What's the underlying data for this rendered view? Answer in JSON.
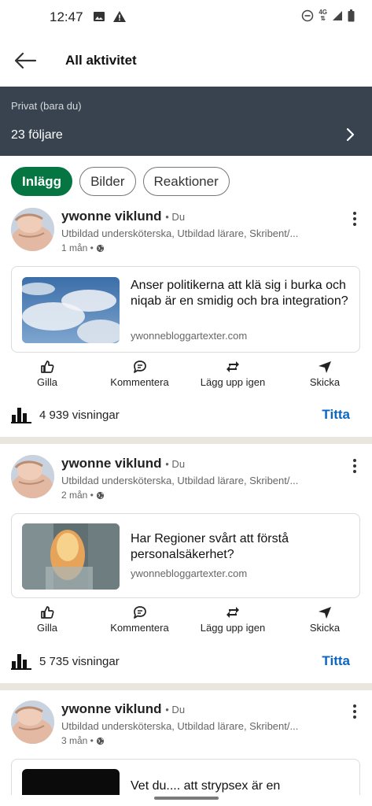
{
  "status_bar": {
    "time": "12:47",
    "network": "4G"
  },
  "header": {
    "title": "All aktivitet"
  },
  "banner": {
    "privacy": "Privat (bara du)",
    "followers": "23 följare"
  },
  "filters": [
    {
      "label": "Inlägg",
      "active": true
    },
    {
      "label": "Bilder",
      "active": false
    },
    {
      "label": "Reaktioner",
      "active": false
    }
  ],
  "actions": {
    "like": "Gilla",
    "comment": "Kommentera",
    "repost": "Lägg upp igen",
    "send": "Skicka"
  },
  "posts": [
    {
      "author": "ywonne viklund",
      "degree": "• Du",
      "headline": "Utbildad undersköterska, Utbildad lärare, Skribent/...",
      "time": "1 mån •",
      "link_title": "Anser politikerna att klä sig i burka och niqab är en smidig och bra integration?",
      "link_domain": "ywonnebloggartexter.com",
      "views": "4 939 visningar",
      "view_cta": "Titta"
    },
    {
      "author": "ywonne viklund",
      "degree": "• Du",
      "headline": "Utbildad undersköterska, Utbildad lärare, Skribent/...",
      "time": "2 mån •",
      "link_title": "Har Regioner svårt att förstå personalsäkerhet?",
      "link_domain": "ywonnebloggartexter.com",
      "views": "5 735 visningar",
      "view_cta": "Titta"
    },
    {
      "author": "ywonne viklund",
      "degree": "• Du",
      "headline": "Utbildad undersköterska, Utbildad lärare, Skribent/...",
      "time": "3 mån •",
      "link_title": "Vet du.... att strypsex är en"
    }
  ],
  "colors": {
    "banner": "#38434f",
    "accent_green": "#057642",
    "link_blue": "#0a66c2"
  }
}
